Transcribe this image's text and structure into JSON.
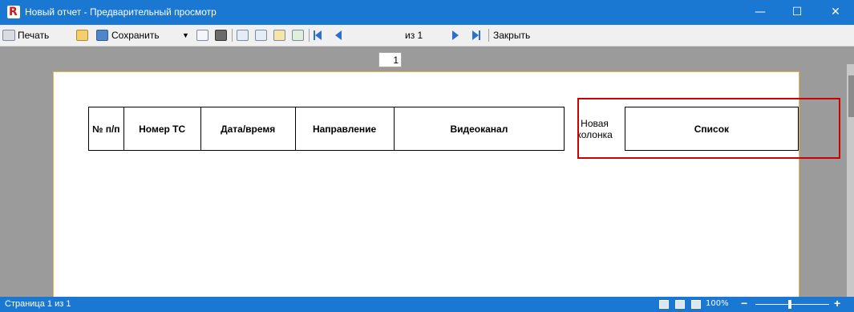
{
  "window": {
    "title": "Новый отчет - Предварительный просмотр",
    "logo_letter": "R",
    "minimize": "—",
    "maximize": "☐",
    "close": "✕"
  },
  "toolbar": {
    "print_label": "Печать",
    "save_label": "Сохранить",
    "page_value": "1",
    "page_of": "из 1",
    "close_label": "Закрыть"
  },
  "report": {
    "headers": [
      "№ п/п",
      "Номер ТС",
      "Дата/время",
      "Направление",
      "Видеоканал"
    ],
    "new_column": "Новая колонка",
    "list_column": "Список"
  },
  "status": {
    "page_text": "Страница 1 из 1",
    "zoom": "100%",
    "zoom_minus": "−",
    "zoom_plus": "+"
  },
  "colors": {
    "titlebar": "#1a77d2",
    "highlight": "#cc0000",
    "page_border": "#e8b84a"
  }
}
